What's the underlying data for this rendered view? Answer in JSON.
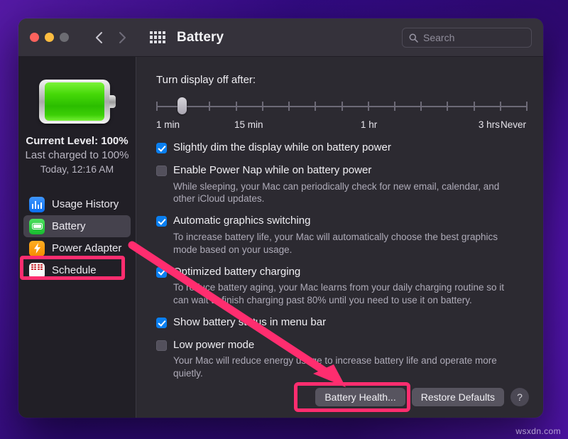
{
  "window": {
    "title": "Battery",
    "traffic_lights": [
      "close",
      "minimize",
      "zoom"
    ],
    "nav_back": "back-arrow",
    "nav_forward": "forward-arrow",
    "grid_button": "show-all-grid",
    "search": {
      "placeholder": "Search",
      "value": "",
      "icon": "search-icon"
    }
  },
  "sidebar": {
    "battery_icon": "battery-full-green",
    "status": {
      "current_level": "Current Level: 100%",
      "last_charged": "Last charged to 100%",
      "timestamp": "Today, 12:16 AM"
    },
    "items": [
      {
        "label": "Usage History",
        "icon": "usage-history-icon",
        "selected": false
      },
      {
        "label": "Battery",
        "icon": "battery-icon",
        "selected": true
      },
      {
        "label": "Power Adapter",
        "icon": "power-adapter-icon",
        "selected": false
      },
      {
        "label": "Schedule",
        "icon": "schedule-icon",
        "selected": false
      }
    ]
  },
  "main": {
    "slider": {
      "label": "Turn display off after:",
      "ticks": 15,
      "thumb_position_percent": 7,
      "scale_labels": [
        {
          "text": "1 min",
          "position_percent": 0
        },
        {
          "text": "15 min",
          "position_percent": 25
        },
        {
          "text": "1 hr",
          "position_percent": 57.5
        },
        {
          "text": "3 hrs",
          "position_percent": 90
        },
        {
          "text": "Never",
          "position_percent": 100
        }
      ]
    },
    "options": [
      {
        "label": "Slightly dim the display while on battery power",
        "checked": true,
        "description": ""
      },
      {
        "label": "Enable Power Nap while on battery power",
        "checked": false,
        "description": "While sleeping, your Mac can periodically check for new email, calendar, and other iCloud updates."
      },
      {
        "label": "Automatic graphics switching",
        "checked": true,
        "description": "To increase battery life, your Mac will automatically choose the best graphics mode based on your usage."
      },
      {
        "label": "Optimized battery charging",
        "checked": true,
        "description": "To reduce battery aging, your Mac learns from your daily charging routine so it can wait to finish charging past 80% until you need to use it on battery."
      },
      {
        "label": "Show battery status in menu bar",
        "checked": true,
        "description": ""
      },
      {
        "label": "Low power mode",
        "checked": false,
        "description": "Your Mac will reduce energy usage to increase battery life and operate more quietly."
      }
    ],
    "buttons": {
      "battery_health": "Battery Health...",
      "restore_defaults": "Restore Defaults",
      "help": "?"
    }
  },
  "annotations": {
    "highlight_color": "#ff2d6f",
    "arrow_color": "#ff2d6f",
    "highlighted_sidebar_item": "Battery",
    "highlighted_button": "Battery Health..."
  },
  "watermark": "wsxdn.com"
}
